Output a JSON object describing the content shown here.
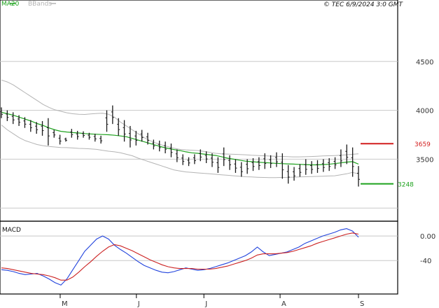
{
  "header": {
    "legend_ma20": "MA20",
    "legend_bbands": "BBands",
    "copyright": "© TEC 6/9/2024 3:0 GMT"
  },
  "colors": {
    "price": "#1a1a1a",
    "ma20": "#1ea21e",
    "bbands": "#b4b4b4",
    "resistance": "#d21e1e",
    "support": "#1ea21e",
    "macd": "#2244dd",
    "signal": "#cc2222",
    "grid": "#c8c8c8"
  },
  "chart_data": [
    {
      "type": "line",
      "panel": "price",
      "y_ticks": [
        {
          "value": 4500,
          "label": "4500"
        },
        {
          "value": 4000,
          "label": "4000"
        },
        {
          "value": 3500,
          "label": "3500"
        }
      ],
      "ylim": [
        2980,
        5000
      ],
      "x_ticks": [
        {
          "x": 27,
          "label": "M"
        },
        {
          "x": 62,
          "label": "J"
        },
        {
          "x": 93,
          "label": "J"
        },
        {
          "x": 128,
          "label": "A"
        },
        {
          "x": 164,
          "label": "S"
        }
      ],
      "xlim": [
        0,
        190
      ],
      "resistance": {
        "value": 3659,
        "label": "3659"
      },
      "support": {
        "value": 3248,
        "label": "3248"
      },
      "series": [
        {
          "name": "MA20",
          "values": [
            3980,
            3965,
            3950,
            3930,
            3910,
            3890,
            3865,
            3845,
            3820,
            3800,
            3785,
            3778,
            3772,
            3768,
            3762,
            3758,
            3755,
            3752,
            3750,
            3745,
            3738,
            3730,
            3712,
            3695,
            3678,
            3660,
            3642,
            3625,
            3610,
            3598,
            3588,
            3575,
            3565,
            3560,
            3552,
            3545,
            3538,
            3525,
            3510,
            3500,
            3490,
            3480,
            3475,
            3470,
            3466,
            3462,
            3458,
            3455,
            3452,
            3450,
            3447,
            3445,
            3442,
            3442,
            3445,
            3448,
            3455,
            3462,
            3470,
            3475,
            3450
          ]
        },
        {
          "name": "BBands upper",
          "values": [
            4310,
            4290,
            4260,
            4220,
            4180,
            4140,
            4100,
            4060,
            4030,
            4005,
            3990,
            3975,
            3965,
            3960,
            3958,
            3963,
            3968,
            3970,
            3960,
            3930,
            3880,
            3840,
            3800,
            3760,
            3720,
            3690,
            3665,
            3645,
            3628,
            3612,
            3600,
            3595,
            3592,
            3588,
            3580,
            3570,
            3560,
            3555,
            3552,
            3550,
            3548,
            3545,
            3540,
            3538,
            3535,
            3532,
            3530,
            3528,
            3526,
            3524,
            3524,
            3525,
            3527,
            3530,
            3533,
            3535,
            3537,
            3540,
            3545,
            3550,
            3555
          ]
        },
        {
          "name": "BBands lower",
          "values": [
            3850,
            3800,
            3760,
            3720,
            3690,
            3670,
            3650,
            3638,
            3630,
            3625,
            3620,
            3618,
            3615,
            3610,
            3608,
            3605,
            3600,
            3590,
            3582,
            3575,
            3565,
            3550,
            3535,
            3510,
            3490,
            3470,
            3450,
            3430,
            3410,
            3390,
            3380,
            3370,
            3365,
            3360,
            3355,
            3350,
            3345,
            3340,
            3335,
            3330,
            3325,
            3320,
            3318,
            3315,
            3313,
            3312,
            3312,
            3313,
            3314,
            3316,
            3318,
            3320,
            3322,
            3324,
            3326,
            3328,
            3330,
            3340,
            3350,
            3365,
            3350
          ]
        },
        {
          "name": "Price",
          "type": "ohlc",
          "highs": [
            4030,
            4000,
            3980,
            3950,
            3930,
            3900,
            3880,
            3890,
            3920,
            3800,
            3750,
            3720,
            3810,
            3790,
            3785,
            3770,
            3760,
            3740,
            4000,
            4050,
            3920,
            3900,
            3840,
            3790,
            3800,
            3770,
            3700,
            3690,
            3680,
            3660,
            3600,
            3550,
            3520,
            3550,
            3600,
            3580,
            3560,
            3520,
            3620,
            3540,
            3500,
            3470,
            3500,
            3510,
            3520,
            3560,
            3540,
            3570,
            3560,
            3440,
            3420,
            3450,
            3500,
            3480,
            3490,
            3500,
            3510,
            3520,
            3600,
            3650,
            3620,
            3430
          ],
          "lows": [
            3920,
            3890,
            3860,
            3840,
            3820,
            3780,
            3760,
            3740,
            3640,
            3720,
            3650,
            3680,
            3720,
            3700,
            3720,
            3700,
            3680,
            3660,
            3780,
            3860,
            3740,
            3680,
            3620,
            3640,
            3680,
            3650,
            3600,
            3580,
            3560,
            3520,
            3470,
            3440,
            3430,
            3450,
            3480,
            3460,
            3420,
            3360,
            3430,
            3390,
            3360,
            3320,
            3350,
            3380,
            3390,
            3400,
            3410,
            3420,
            3300,
            3250,
            3280,
            3320,
            3340,
            3350,
            3360,
            3370,
            3380,
            3400,
            3420,
            3450,
            3320,
            3220
          ]
        }
      ]
    },
    {
      "type": "line",
      "panel": "macd",
      "title": "MACD",
      "y_ticks": [
        {
          "value": 0,
          "label": "0.00"
        },
        {
          "value": -40,
          "label": "-40"
        }
      ],
      "ylim": [
        -90,
        15
      ],
      "series": [
        {
          "name": "MACD",
          "values": [
            -55,
            -56,
            -58,
            -61,
            -63,
            -62,
            -61,
            -65,
            -70,
            -76,
            -80,
            -70,
            -55,
            -40,
            -25,
            -15,
            -5,
            0,
            -5,
            -15,
            -22,
            -28,
            -35,
            -42,
            -48,
            -52,
            -56,
            -59,
            -60,
            -58,
            -55,
            -52,
            -54,
            -56,
            -55,
            -53,
            -50,
            -47,
            -44,
            -40,
            -36,
            -32,
            -26,
            -18,
            -26,
            -32,
            -30,
            -28,
            -26,
            -22,
            -18,
            -12,
            -8,
            -4,
            0,
            3,
            6,
            10,
            12,
            8,
            -2
          ]
        },
        {
          "name": "Signal",
          "values": [
            -52,
            -53,
            -55,
            -57,
            -59,
            -61,
            -62,
            -63,
            -65,
            -68,
            -72,
            -72,
            -67,
            -59,
            -50,
            -42,
            -33,
            -25,
            -18,
            -14,
            -16,
            -20,
            -24,
            -29,
            -34,
            -39,
            -43,
            -47,
            -50,
            -52,
            -53,
            -53,
            -53,
            -54,
            -54,
            -54,
            -53,
            -51,
            -49,
            -46,
            -43,
            -40,
            -36,
            -31,
            -29,
            -29,
            -29,
            -28,
            -27,
            -25,
            -22,
            -19,
            -16,
            -12,
            -9,
            -6,
            -3,
            0,
            3,
            5,
            3
          ]
        }
      ]
    }
  ]
}
